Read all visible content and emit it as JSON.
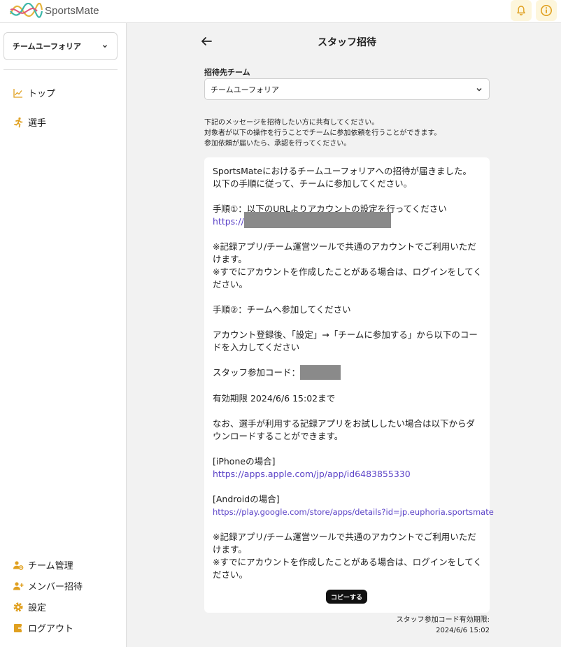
{
  "header": {
    "app_name": "SportsMate",
    "icons": [
      "bell-icon",
      "info-icon"
    ]
  },
  "sidebar": {
    "team_select": "チームユーフォリア",
    "top_items": [
      {
        "label": "トップ",
        "icon": "chart-icon"
      },
      {
        "label": "選手",
        "icon": "runner-icon"
      }
    ],
    "bottom_items": [
      {
        "label": "チーム管理",
        "icon": "team-gear-icon"
      },
      {
        "label": "メンバー招待",
        "icon": "add-user-icon"
      },
      {
        "label": "設定",
        "icon": "gear-icon"
      },
      {
        "label": "ログアウト",
        "icon": "logout-icon"
      }
    ]
  },
  "main": {
    "title": "スタッフ招待",
    "team_field_label": "招待先チーム",
    "team_field_value": "チームユーフォリア",
    "instructions": [
      "下記のメッセージを招待したい方に共有してください。",
      "対象者が以下の操作を行うことでチームに参加依頼を行うことができます。",
      "参加依頼が届いたら、承認を行ってください。"
    ],
    "message": {
      "intro_1": "SportsMateにおけるチームユーフォリアへの招待が届きました。",
      "intro_2": "以下の手順に従って、チームに参加してください。",
      "step1": "手順①：以下のURLよりアカウントの設定を行ってください",
      "step1_url_prefix": "https://",
      "note_1": "※記録アプリ/チーム運営ツールで共通のアカウントでご利用いただけます。",
      "note_2": "※すでにアカウントを作成したことがある場合は、ログインをしてください。",
      "step2": "手順②：チームへ参加してください",
      "step2_detail": "アカウント登録後、「設定」→「チームに参加する」から以下のコードを入力してください",
      "code_label": "スタッフ参加コード：",
      "validity": "有効期限 2024/6/6 15:02まで",
      "trial": "なお、選手が利用する記録アプリをお試ししたい場合は以下からダウンロードすることができます。",
      "iphone_label": "[iPhoneの場合]",
      "iphone_url": "https://apps.apple.com/jp/app/id6483855330",
      "android_label": "[Androidの場合]",
      "android_url": "https://play.google.com/store/apps/details?id=jp.euphoria.sportsmate",
      "note_3": "※記録アプリ/チーム運営ツールで共通のアカウントでご利用いただけます。",
      "note_4": "※すでにアカウントを作成したことがある場合は、ログインをしてください。"
    },
    "copy_button": "コピーする",
    "expiry_label": "スタッフ参加コード有効期限:",
    "expiry_value": "2024/6/6 15:02"
  },
  "colors": {
    "brand_yellow": "#e2b23a",
    "link": "#5b42c7",
    "header_button_bg": "#fdf6dc"
  }
}
